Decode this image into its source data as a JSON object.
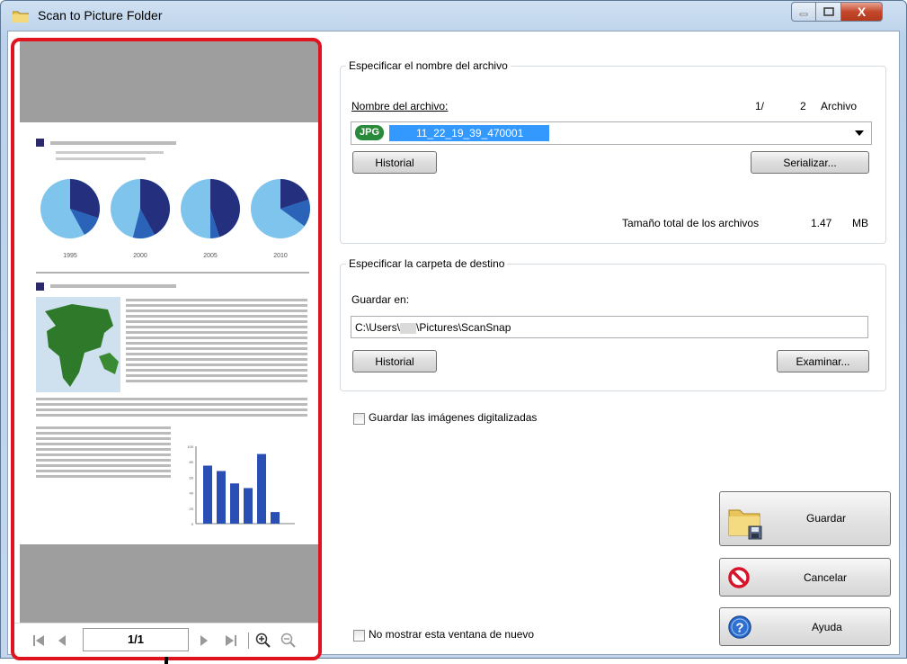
{
  "window": {
    "title": "Scan to Picture Folder",
    "close_glyph": "X"
  },
  "preview": {
    "page_indicator": "1/1",
    "pie_years": [
      "1995",
      "2000",
      "2005",
      "2010"
    ],
    "pie_values": [
      {
        "dark": 0.3,
        "mid": 0.12
      },
      {
        "dark": 0.42,
        "mid": 0.12
      },
      {
        "dark": 0.45,
        "mid": 0.05
      },
      {
        "dark": 0.2,
        "mid": 0.15
      }
    ],
    "bar_chart_values": [
      75,
      68,
      52,
      46,
      90,
      15
    ],
    "bar_axis_ticks": [
      "100",
      "80",
      "60",
      "40",
      "20",
      "0"
    ]
  },
  "file_section": {
    "legend": "Especificar el nombre del archivo",
    "name_label": "Nombre del archivo:",
    "counter_current": "1/",
    "counter_total": "2",
    "counter_unit": "Archivo",
    "format_badge": "JPG",
    "filename_value": "11_22_19_39_470001",
    "history_button": "Historial",
    "serialize_button": "Serializar...",
    "total_size_label": "Tamaño total de los archivos",
    "total_size_value": "1.47",
    "total_size_unit": "MB"
  },
  "folder_section": {
    "legend": "Especificar la carpeta de destino",
    "save_in_label": "Guardar en:",
    "path_prefix": "C:\\Users\\",
    "path_suffix": "\\Pictures\\ScanSnap",
    "history_button": "Historial",
    "browse_button": "Examinar..."
  },
  "options": {
    "save_scanned_label": "Guardar las imágenes digitalizadas",
    "dont_show_label": "No mostrar esta ventana de nuevo"
  },
  "actions": {
    "save": "Guardar",
    "cancel": "Cancelar",
    "help": "Ayuda"
  },
  "colors": {
    "highlight_border": "#e0141e",
    "selection": "#3399ff",
    "jpg_badge": "#2a8a3c"
  }
}
